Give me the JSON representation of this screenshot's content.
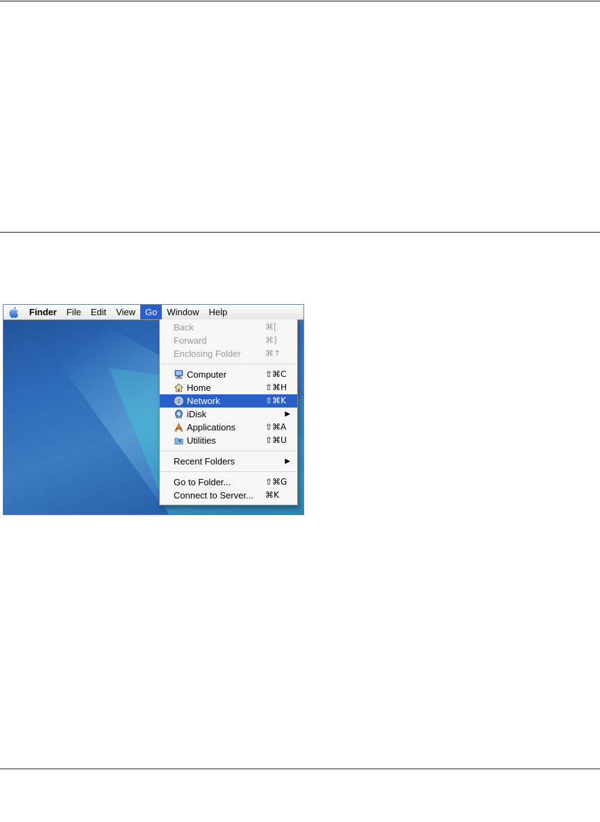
{
  "menubar": {
    "apple_icon": "apple-icon",
    "items": [
      "Finder",
      "File",
      "Edit",
      "View",
      "Go",
      "Window",
      "Help"
    ],
    "active": "Go"
  },
  "go_menu": {
    "back": {
      "label": "Back",
      "shortcut": "⌘["
    },
    "forward": {
      "label": "Forward",
      "shortcut": "⌘]"
    },
    "enclosing": {
      "label": "Enclosing Folder",
      "shortcut": "⌘↑"
    },
    "computer": {
      "label": "Computer",
      "shortcut": "⇧⌘C",
      "icon": "computer-icon"
    },
    "home": {
      "label": "Home",
      "shortcut": "⇧⌘H",
      "icon": "home-icon"
    },
    "network": {
      "label": "Network",
      "shortcut": "⇧⌘K",
      "icon": "network-icon"
    },
    "idisk": {
      "label": "iDisk",
      "icon": "idisk-icon"
    },
    "applications": {
      "label": "Applications",
      "shortcut": "⇧⌘A",
      "icon": "applications-icon"
    },
    "utilities": {
      "label": "Utilities",
      "shortcut": "⇧⌘U",
      "icon": "utilities-icon"
    },
    "recent": {
      "label": "Recent Folders"
    },
    "goto_folder": {
      "label": "Go to Folder...",
      "shortcut": "⇧⌘G"
    },
    "connect": {
      "label": "Connect to Server...",
      "shortcut": "⌘K"
    }
  },
  "colors": {
    "highlight": "#2a5fc8",
    "desktop": "#2d6ab7"
  }
}
